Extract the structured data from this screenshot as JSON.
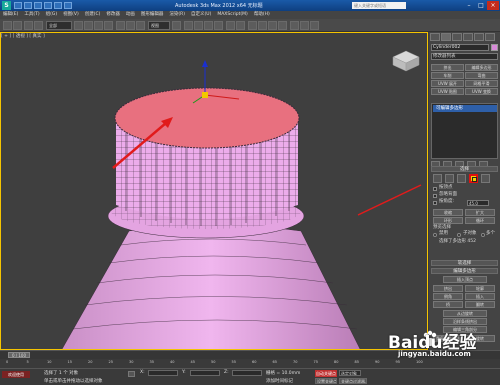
{
  "window": {
    "title": "Autodesk 3ds Max 2012 x64 无标题",
    "search_placeholder": "键入关键字或短语"
  },
  "menu": {
    "items": [
      "编辑(E)",
      "工具(T)",
      "组(G)",
      "视图(V)",
      "创建(C)",
      "修改器",
      "动画",
      "图形编辑器",
      "渲染(R)",
      "自定义(U)",
      "MAXScript(M)",
      "帮助(H)"
    ]
  },
  "toolbar": {
    "selection_filter": "全部",
    "ref_coord": "视图"
  },
  "viewport": {
    "label": "[ + ] [ 透视 ] [ 真实 ]",
    "colors": {
      "object": "#e9a6e6",
      "cap_top": "#e8707f",
      "wire": "#3a2a3a",
      "arrow": "#e11b1b",
      "active_border": "#f5c400"
    }
  },
  "command_panel": {
    "object_name": "Cylinder002",
    "modifier_list": "修改器列表",
    "buttons": [
      [
        "挤出",
        "编辑多边形"
      ],
      [
        "车削",
        "弯曲"
      ],
      [
        "UVW 展开",
        "网格平滑"
      ],
      [
        "UVW 贴图",
        "UVW 变换"
      ]
    ],
    "stack_item": "可编辑多边形",
    "rollout_selection": "选择",
    "by_vertex": "按顶点",
    "ignore_backfacing": "忽略背面",
    "by_angle": "按角度:",
    "angle_value": "45.0",
    "shrink": "收缩",
    "grow": "扩大",
    "ring": "环形",
    "loop": "循环",
    "preview_selection": "预览选择",
    "off": "禁用",
    "subobj": "子对象",
    "multi": "多个",
    "selected_count": "选择了多边形 452",
    "rollout_soft": "软选择",
    "rollout_edit_polys": "编辑多边形",
    "insert_vertex": "插入顶点",
    "extrude": "挤出",
    "outline": "轮廓",
    "bevel": "倒角",
    "inset": "插入",
    "bridge": "桥",
    "flip": "翻转",
    "from_edge": "从边旋转",
    "along_spline": "沿样条线挤出",
    "edit_tri": "编辑三角剖分",
    "retri": "重复三角算法",
    "turn": "旋转"
  },
  "timeline": {
    "frame_display": "0 / 100",
    "ticks": [
      "0",
      "5",
      "10",
      "15",
      "20",
      "25",
      "30",
      "35",
      "40",
      "45",
      "50",
      "55",
      "60",
      "65",
      "70",
      "75",
      "80",
      "85",
      "90",
      "95",
      "100"
    ]
  },
  "status_bar": {
    "welcome": "欢迎使用",
    "selected": "选择了 1 个 对象",
    "prompt": "单击或单击并拖动以选择对象",
    "x_label": "X:",
    "y_label": "Y:",
    "z_label": "Z:",
    "grid": "栅格 = 10.0mm",
    "auto_key": "自动关键点",
    "selected_obj": "选定对象",
    "set_key": "设置关键点",
    "key_filter": "关键点过滤器...",
    "add_time_tag": "添加时间标记"
  },
  "watermark": {
    "brand": "Baidu经验",
    "url": "jingyan.baidu.com"
  }
}
